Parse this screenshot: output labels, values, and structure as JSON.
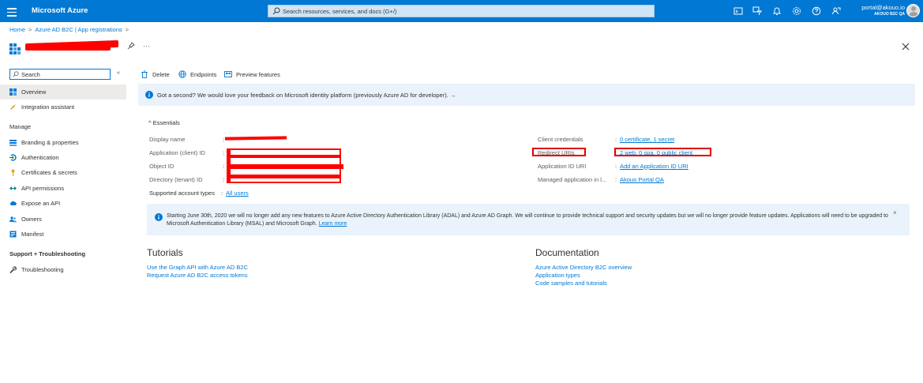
{
  "topbar": {
    "brand": "Microsoft Azure",
    "search_placeholder": "Search resources, services, and docs (G+/)",
    "icons": [
      "cloud-shell-icon",
      "directory-filter-icon",
      "notifications-icon",
      "settings-icon",
      "help-icon",
      "feedback-icon"
    ],
    "account_email": "portal@akouo.io",
    "account_org": "AKOUO B2C QA"
  },
  "breadcrumb": {
    "home": "Home",
    "parent": "Azure AD B2C | App registrations"
  },
  "title": {
    "more": "···"
  },
  "sidebar": {
    "search_placeholder": "Search",
    "collapse": "«",
    "top_items": [
      {
        "label": "Overview",
        "icon": "overview-icon"
      },
      {
        "label": "Integration assistant",
        "icon": "rocket-icon"
      }
    ],
    "manage_heading": "Manage",
    "manage_items": [
      {
        "label": "Branding & properties",
        "icon": "branding-icon"
      },
      {
        "label": "Authentication",
        "icon": "authentication-icon"
      },
      {
        "label": "Certificates & secrets",
        "icon": "key-icon"
      },
      {
        "label": "API permissions",
        "icon": "api-permissions-icon"
      },
      {
        "label": "Expose an API",
        "icon": "cloud-icon"
      },
      {
        "label": "Owners",
        "icon": "owners-icon"
      },
      {
        "label": "Manifest",
        "icon": "manifest-icon"
      }
    ],
    "support_heading": "Support + Troubleshooting",
    "support_items": [
      {
        "label": "Troubleshooting",
        "icon": "wrench-icon"
      }
    ]
  },
  "toolbar": {
    "delete": "Delete",
    "endpoints": "Endpoints",
    "preview": "Preview features"
  },
  "feedback_banner": {
    "text": "Got a second? We would love your feedback on Microsoft identity platform (previously Azure AD for developer).",
    "arrow": "→"
  },
  "essentials": {
    "toggle": "Essentials",
    "left": {
      "display_name": "Display name",
      "client_id": "Application (client) ID",
      "object_id": "Object ID",
      "tenant_id": "Directory (tenant) ID",
      "account_types": "Supported account types",
      "account_types_value": "All users"
    },
    "right": {
      "client_credentials": "Client credentials",
      "client_credentials_value": "0 certificate, 1 secret",
      "redirect_uris": "Redirect URIs",
      "redirect_uris_value": "2 web, 0 spa, 0 public client",
      "app_id_uri": "Application ID URI",
      "app_id_uri_value": "Add an Application ID URI",
      "managed_app": "Managed application in l...",
      "managed_app_value": "Akouo Portal QA"
    },
    "colon": ":"
  },
  "notice": {
    "text": "Starting June 30th, 2020 we will no longer add any new features to Azure Active Directory Authentication Library (ADAL) and Azure AD Graph. We will continue to provide technical support and security updates but we will no longer provide feature updates. Applications will need to be upgraded to Microsoft Authentication Library (MSAL) and Microsoft Graph.",
    "link": "Learn more",
    "close": "×"
  },
  "tutorials": {
    "heading": "Tutorials",
    "links": [
      "Use the Graph API with Azure AD B2C",
      "Request Azure AD B2C access tokens"
    ]
  },
  "documentation": {
    "heading": "Documentation",
    "links": [
      "Azure Active Directory B2C overview",
      "Application types",
      "Code samples and tutorials"
    ]
  },
  "colors": {
    "accent": "#0078d4",
    "redaction": "#ff0000",
    "banner_bg": "#eaf3fb",
    "selected_bg": "#edebe9"
  }
}
